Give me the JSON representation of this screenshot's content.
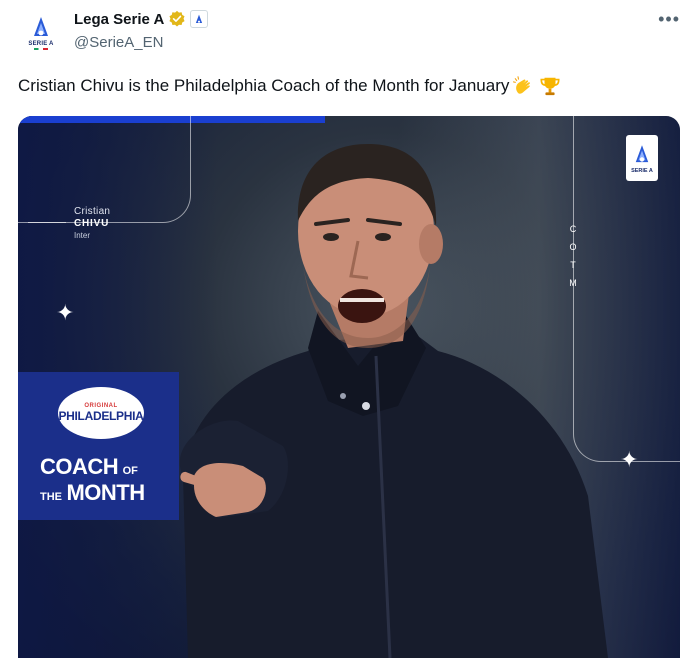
{
  "author": {
    "display_name": "Lega Serie A",
    "handle": "@SerieA_EN",
    "avatar_label": "SERIE A"
  },
  "icons": {
    "verified": "verified-gold-badge-icon",
    "affiliate": "serie-a-affiliate-icon",
    "more": "more-options-icon"
  },
  "tweet": {
    "text": "Cristian Chivu is the Philadelphia Coach of the Month for January",
    "emojis": [
      "clapping-hands-emoji",
      "trophy-emoji"
    ]
  },
  "media": {
    "coach_first_name": "Cristian",
    "coach_last_name": "CHIVU",
    "coach_team": "Inter",
    "vertical_tag": [
      "C",
      "O",
      "T",
      "M"
    ],
    "league_logo_text": "SERIE A",
    "brand_small": "ORIGINAL",
    "brand_name": "PHILADELPHIA",
    "award_line1_big": "COACH",
    "award_line1_small": "OF",
    "award_line2_small": "THE",
    "award_line2_big": "MONTH"
  },
  "colors": {
    "accent_blue": "#1a3fd0",
    "panel_blue": "#1b2f8a",
    "verified_gold": "#e2b719"
  }
}
